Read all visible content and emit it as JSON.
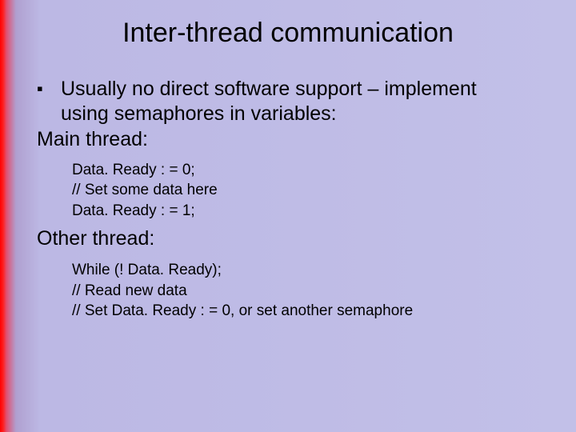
{
  "slide": {
    "title": "Inter-thread communication",
    "bullet1_line1": "Usually no direct software support – implement",
    "bullet1_line2": "using semaphores in variables:",
    "main_thread_label": "Main thread:",
    "main_code": {
      "l1": "Data. Ready : = 0;",
      "l2": "// Set some data here",
      "l3": "Data. Ready : = 1;"
    },
    "other_thread_label": "Other thread:",
    "other_code": {
      "l1": "While (! Data. Ready);",
      "l2": "// Read new data",
      "l3": "// Set Data. Ready : = 0, or set another semaphore"
    }
  }
}
